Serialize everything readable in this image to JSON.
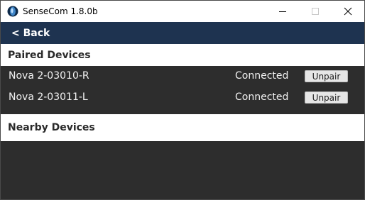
{
  "window": {
    "title": "SenseCom 1.8.0b"
  },
  "window_controls": {
    "minimize": "minimize-icon",
    "maximize": "maximize-icon",
    "close": "close-icon"
  },
  "nav": {
    "back_label": "< Back"
  },
  "paired": {
    "header": "Paired Devices",
    "devices": [
      {
        "name": "Nova 2-03010-R",
        "status": "Connected",
        "action": "Unpair"
      },
      {
        "name": "Nova 2-03011-L",
        "status": "Connected",
        "action": "Unpair"
      }
    ]
  },
  "nearby": {
    "header": "Nearby Devices"
  },
  "colors": {
    "navbar": "#1e3350",
    "content_bg": "#2d2d2d",
    "header_bg": "#ffffff",
    "text_light": "#f2f2f2",
    "app_icon_blue": "#1b4f8a"
  }
}
